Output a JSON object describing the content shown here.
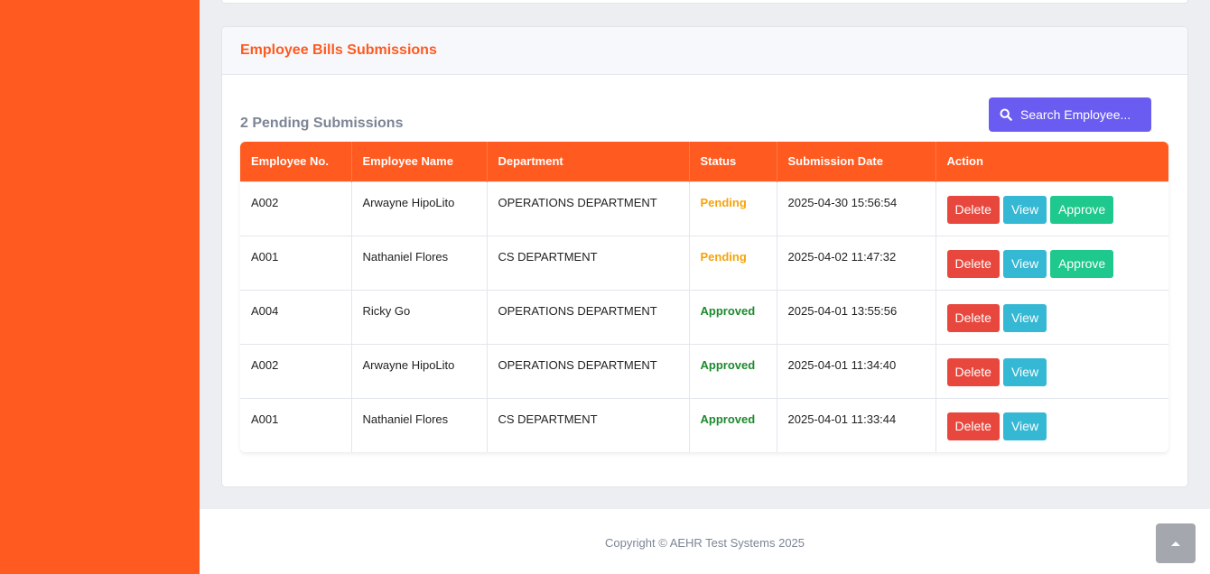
{
  "card": {
    "title": "Employee Bills Submissions"
  },
  "pending_title": "2 Pending Submissions",
  "search": {
    "label": "Search Employee...",
    "icon": "search-icon",
    "color": "#6a5cf0"
  },
  "table": {
    "columns": [
      "Employee No.",
      "Employee Name",
      "Department",
      "Status",
      "Submission Date",
      "Action"
    ],
    "rows": [
      {
        "emp_no": "A002",
        "name": "Arwayne HipoLito",
        "department": "OPERATIONS DEPARTMENT",
        "status": "Pending",
        "date": "2025-04-30 15:56:54",
        "actions": [
          "Delete",
          "View",
          "Approve"
        ]
      },
      {
        "emp_no": "A001",
        "name": "Nathaniel Flores",
        "department": "CS DEPARTMENT",
        "status": "Pending",
        "date": "2025-04-02 11:47:32",
        "actions": [
          "Delete",
          "View",
          "Approve"
        ]
      },
      {
        "emp_no": "A004",
        "name": "Ricky Go",
        "department": "OPERATIONS DEPARTMENT",
        "status": "Approved",
        "date": "2025-04-01 13:55:56",
        "actions": [
          "Delete",
          "View"
        ]
      },
      {
        "emp_no": "A002",
        "name": "Arwayne HipoLito",
        "department": "OPERATIONS DEPARTMENT",
        "status": "Approved",
        "date": "2025-04-01 11:34:40",
        "actions": [
          "Delete",
          "View"
        ]
      },
      {
        "emp_no": "A001",
        "name": "Nathaniel Flores",
        "department": "CS DEPARTMENT",
        "status": "Approved",
        "date": "2025-04-01 11:33:44",
        "actions": [
          "Delete",
          "View"
        ]
      }
    ]
  },
  "footer": {
    "copyright": "Copyright © AEHR Test Systems 2025"
  },
  "scroll_top": {
    "icon": "chevron-up-icon"
  },
  "colors": {
    "brand": "#ff5a1f",
    "pending": "#f5a30a",
    "approved": "#1c8a2e",
    "delete": "#e8473d",
    "view": "#35b8d3",
    "approve": "#1fc88d"
  }
}
